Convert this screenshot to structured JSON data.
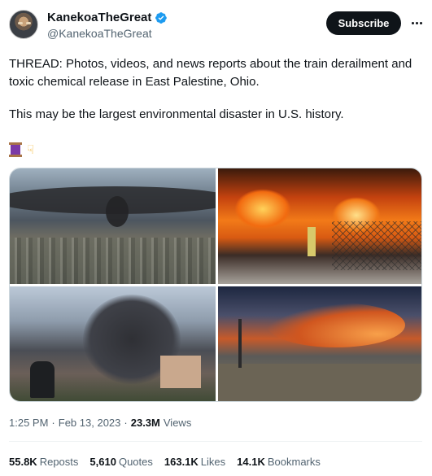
{
  "author": {
    "display_name": "KanekoaTheGreat",
    "handle": "@KanekoaTheGreat",
    "verified_icon": "verified-badge-icon"
  },
  "actions": {
    "subscribe_label": "Subscribe",
    "more_icon": "more-options-icon"
  },
  "tweet": {
    "text_line1": "THREAD: Photos, videos, and news reports about the train derailment and toxic chemical release in East Palestine, Ohio.",
    "text_line2": "This may be the largest environmental disaster in U.S. history.",
    "emojis": [
      "spool-of-thread-icon",
      "pointing-down-icon"
    ]
  },
  "media": {
    "photos": [
      {
        "name": "aerial-smoke-plume-photo"
      },
      {
        "name": "train-fire-firefighter-photo"
      },
      {
        "name": "smoke-over-town-photo"
      },
      {
        "name": "fire-at-night-field-photo"
      }
    ]
  },
  "meta": {
    "time": "1:25 PM",
    "sep1": "·",
    "date": "Feb 13, 2023",
    "sep2": "·",
    "views_count": "23.3M",
    "views_label": "Views"
  },
  "stats": {
    "reposts_count": "55.8K",
    "reposts_label": "Reposts",
    "quotes_count": "5,610",
    "quotes_label": "Quotes",
    "likes_count": "163.1K",
    "likes_label": "Likes",
    "bookmarks_count": "14.1K",
    "bookmarks_label": "Bookmarks"
  }
}
